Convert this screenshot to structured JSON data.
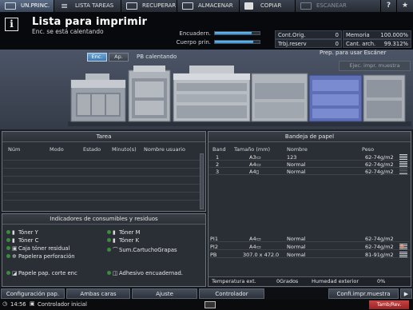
{
  "top_tabs": [
    {
      "label": "UN.PRINC.",
      "active": true
    },
    {
      "label": "LISTA TAREAS"
    },
    {
      "label": "RECUPERAR"
    },
    {
      "label": "ALMACENAR"
    },
    {
      "label": "COPIAR"
    },
    {
      "label": "ESCANEAR",
      "disabled": true
    }
  ],
  "top_icons": {
    "help": "?",
    "favorite": "★"
  },
  "status": {
    "title": "Lista para imprimir",
    "subtitle": "Enc. se está calentando",
    "meters": [
      {
        "label": "Encuadern.",
        "fill": 0.82
      },
      {
        "label": "Cuerpo prin.",
        "fill": 0.86
      }
    ],
    "counters": [
      {
        "label": "Cont.Orig.",
        "value": "0"
      },
      {
        "label": "Memoria",
        "value": "100.000%"
      },
      {
        "label": "Trbj.reserv",
        "value": "0"
      },
      {
        "label": "Cant. arch.",
        "value": "99.312%"
      }
    ]
  },
  "machine": {
    "enc_label": "Enc.",
    "ap_label": "Ap.",
    "pb_status": "PB calentando",
    "scan_ready": "Prep. para usar Escáner",
    "sample_button": "Ejec. impr. muestra"
  },
  "task_panel": {
    "title": "Tarea",
    "columns": [
      "Núm",
      "Modo",
      "Estado",
      "Minuto(s)",
      "Nombre usuario"
    ]
  },
  "consumables": {
    "title": "Indicadores de consumibles y residuos",
    "items": [
      {
        "label": "Tóner Y",
        "icon": "toner-bottle-icon"
      },
      {
        "label": "Tóner M",
        "icon": "toner-bottle-icon"
      },
      {
        "label": "Tóner C",
        "icon": "toner-bottle-icon"
      },
      {
        "label": "Tóner K",
        "icon": "toner-bottle-icon"
      },
      {
        "label": "Caja tóner residual",
        "icon": "waste-box-icon"
      },
      {
        "label": "Sum.CartuchoGrapas",
        "icon": "staple-icon"
      },
      {
        "label": "Papelera perforación",
        "icon": "punch-icon"
      },
      {
        "label": "Papele pap. corte enc",
        "icon": "trim-icon"
      },
      {
        "label": "Adhesivo encuadernad.",
        "icon": "glue-icon"
      }
    ],
    "status_color": "#3d8b3d"
  },
  "tray_panel": {
    "title": "Bandeja de papel",
    "columns": [
      "Band",
      "Tamaño (mm)",
      "Nombre",
      "Peso"
    ],
    "trays": [
      {
        "band": "1",
        "size": "A3▭",
        "name": "123",
        "weight": "62-74g/m2",
        "level": 4
      },
      {
        "band": "2",
        "size": "A4▭",
        "name": "Normal",
        "weight": "62-74g/m2",
        "level": 4
      },
      {
        "band": "3",
        "size": "A4▯",
        "name": "Normal",
        "weight": "62-74g/m2",
        "level": 1
      },
      {
        "band": "PI1",
        "size": "A4▭",
        "name": "Normal",
        "weight": "62-74g/m2",
        "level": 0,
        "alert": true
      },
      {
        "band": "PI2",
        "size": "A4▭",
        "name": "Normal",
        "weight": "62-74g/m2",
        "level": 4
      },
      {
        "band": "PB",
        "size": "307.0 x 472.0",
        "name": "Normal",
        "weight": "81-91g/m2",
        "level": 4
      }
    ],
    "temp_label": "Temperatura ext.",
    "temp_value": "0Grados",
    "humidity_label": "Humedad exterior",
    "humidity_value": "0%"
  },
  "bottom_buttons": [
    "Configuración pap.",
    "Ambas caras",
    "Ajuste",
    "Controlador",
    "Confi.impr.muestra"
  ],
  "statusbar": {
    "time": "14:56",
    "controller": "Controlador inicial",
    "tam": "Tamb/Rev."
  }
}
